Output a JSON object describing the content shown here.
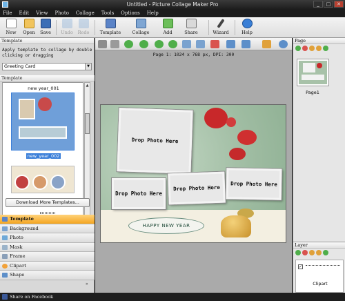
{
  "window": {
    "title": "Untitled - Picture Collage Maker Pro",
    "controls": [
      "_",
      "□",
      "✕"
    ]
  },
  "menu": [
    "File",
    "Edit",
    "View",
    "Photo",
    "Collage",
    "Tools",
    "Options",
    "Help"
  ],
  "toolbar": {
    "new": "New",
    "open": "Open",
    "save": "Save",
    "undo": "Undo",
    "redo": "Redo",
    "template": "Template",
    "collage": "Collage",
    "add": "Add",
    "share": "Share",
    "wizard": "Wizard",
    "help": "Help"
  },
  "left_panel": {
    "header": "Template",
    "hint": "Apply template to collage by double clicking or dragging",
    "category_select": "Greeting Card",
    "list_header": "Template",
    "templates": [
      {
        "caption": "new year_001"
      },
      {
        "caption": "new_year_002",
        "selected": true
      }
    ],
    "download_button": "Download More Templates...",
    "categories": [
      "Template",
      "Background",
      "Photo",
      "Mask",
      "Frame",
      "Clipart",
      "Shape"
    ],
    "more": "»"
  },
  "canvas": {
    "page_info": "Page 1: 1024 x 768 px, DPI: 300",
    "drop_text": "Drop Photo Here",
    "greeting": "HAPPY NEW YEAR"
  },
  "right_panel": {
    "page_header": "Page",
    "page_caption": "Page1",
    "layer_header": "Layer",
    "layer_item": "Clipart"
  },
  "status": {
    "facebook": "Share on Facebook"
  },
  "colors": {
    "accent": "#f4a521",
    "canvas_bg": "#a8c2a9",
    "selection": "#3b7fd9"
  }
}
